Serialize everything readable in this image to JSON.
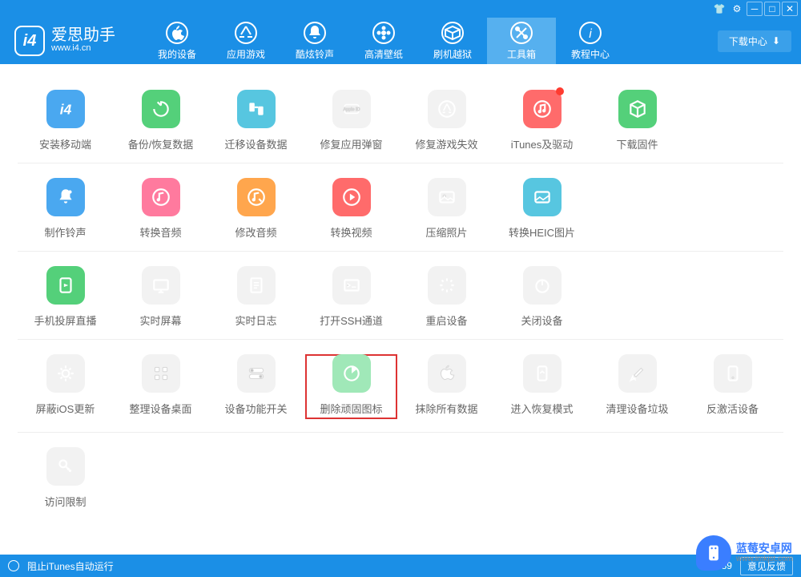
{
  "app": {
    "title": "爱思助手",
    "subtitle": "www.i4.cn"
  },
  "nav": {
    "items": [
      {
        "label": "我的设备"
      },
      {
        "label": "应用游戏"
      },
      {
        "label": "酷炫铃声"
      },
      {
        "label": "高清壁纸"
      },
      {
        "label": "刷机越狱"
      },
      {
        "label": "工具箱"
      },
      {
        "label": "教程中心"
      }
    ],
    "download_center": "下载中心"
  },
  "sections": [
    {
      "tools": [
        {
          "label": "安装移动端",
          "icon": "i4",
          "color": "c-blue"
        },
        {
          "label": "备份/恢复数据",
          "icon": "restore",
          "color": "c-green"
        },
        {
          "label": "迁移设备数据",
          "icon": "migrate",
          "color": "c-cyan"
        },
        {
          "label": "修复应用弹窗",
          "icon": "appleid",
          "color": "c-gray",
          "faded": true
        },
        {
          "label": "修复游戏失效",
          "icon": "appstore",
          "color": "c-gray",
          "faded": true
        },
        {
          "label": "iTunes及驱动",
          "icon": "music",
          "color": "c-red",
          "badge": true
        },
        {
          "label": "下载固件",
          "icon": "cube",
          "color": "c-green"
        }
      ]
    },
    {
      "tools": [
        {
          "label": "制作铃声",
          "icon": "bell",
          "color": "c-blue"
        },
        {
          "label": "转换音频",
          "icon": "audio",
          "color": "c-pink"
        },
        {
          "label": "修改音频",
          "icon": "audio-edit",
          "color": "c-orange"
        },
        {
          "label": "转换视频",
          "icon": "play",
          "color": "c-red"
        },
        {
          "label": "压缩照片",
          "icon": "photo",
          "color": "c-gray",
          "faded": true
        },
        {
          "label": "转换HEIC图片",
          "icon": "heic",
          "color": "c-cyan"
        }
      ]
    },
    {
      "tools": [
        {
          "label": "手机投屏直播",
          "icon": "screen",
          "color": "c-green"
        },
        {
          "label": "实时屏幕",
          "icon": "monitor",
          "color": "c-gray",
          "faded": true
        },
        {
          "label": "实时日志",
          "icon": "log",
          "color": "c-gray",
          "faded": true
        },
        {
          "label": "打开SSH通道",
          "icon": "ssh",
          "color": "c-gray",
          "faded": true
        },
        {
          "label": "重启设备",
          "icon": "loading",
          "color": "c-gray",
          "faded": true
        },
        {
          "label": "关闭设备",
          "icon": "power",
          "color": "c-gray",
          "faded": true
        }
      ]
    },
    {
      "tools": [
        {
          "label": "屏蔽iOS更新",
          "icon": "gear",
          "color": "c-lblue",
          "faded": true
        },
        {
          "label": "整理设备桌面",
          "icon": "grid",
          "color": "c-lpink",
          "faded": true
        },
        {
          "label": "设备功能开关",
          "icon": "toggle",
          "color": "c-gray",
          "faded": true
        },
        {
          "label": "删除顽固图标",
          "icon": "pie",
          "color": "c-lgreen",
          "highlight": true
        },
        {
          "label": "抹除所有数据",
          "icon": "apple",
          "color": "c-gray",
          "faded": true
        },
        {
          "label": "进入恢复模式",
          "icon": "recovery",
          "color": "c-lpink",
          "faded": true
        },
        {
          "label": "清理设备垃圾",
          "icon": "clean",
          "color": "c-lblue",
          "faded": true
        },
        {
          "label": "反激活设备",
          "icon": "device",
          "color": "c-gray",
          "faded": true
        }
      ]
    },
    {
      "tools": [
        {
          "label": "访问限制",
          "icon": "key",
          "color": "c-lpurple",
          "faded": true
        }
      ]
    }
  ],
  "statusbar": {
    "block_itunes": "阻止iTunes自动运行",
    "version": "V7.89",
    "feedback": "意见反馈"
  },
  "watermark": {
    "title": "蓝莓安卓网",
    "url": "www.lmkjst.com"
  }
}
